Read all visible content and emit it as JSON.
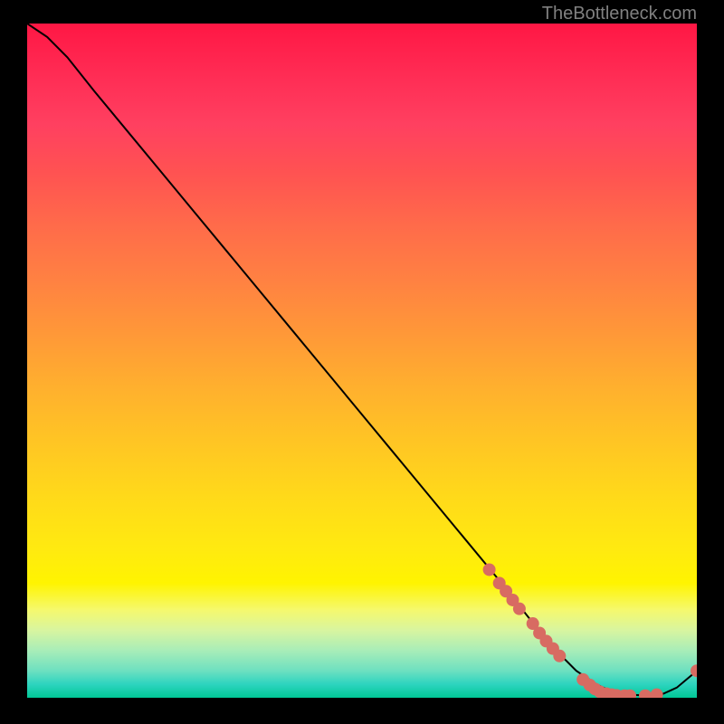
{
  "attribution": "TheBottleneck.com",
  "chart_data": {
    "type": "line",
    "title": "",
    "xlabel": "",
    "ylabel": "",
    "xlim": [
      0,
      100
    ],
    "ylim": [
      0,
      100
    ],
    "series": [
      {
        "name": "curve",
        "x": [
          0,
          3,
          6,
          10,
          15,
          20,
          25,
          30,
          35,
          40,
          45,
          50,
          55,
          60,
          65,
          70,
          74,
          78,
          82,
          85,
          88,
          91,
          93,
          95,
          97,
          100
        ],
        "y": [
          100,
          98,
          95,
          90,
          84,
          78,
          72,
          66,
          60,
          54,
          48,
          42,
          36,
          30,
          24,
          18,
          13,
          8,
          4,
          2,
          0.6,
          0.4,
          0.3,
          0.6,
          1.5,
          4
        ],
        "color": "#000000"
      }
    ],
    "markers": [
      {
        "x": 69.0,
        "y": 19.0
      },
      {
        "x": 70.5,
        "y": 17.0
      },
      {
        "x": 71.5,
        "y": 15.8
      },
      {
        "x": 72.5,
        "y": 14.5
      },
      {
        "x": 73.5,
        "y": 13.2
      },
      {
        "x": 75.5,
        "y": 11.0
      },
      {
        "x": 76.5,
        "y": 9.6
      },
      {
        "x": 77.5,
        "y": 8.4
      },
      {
        "x": 78.5,
        "y": 7.3
      },
      {
        "x": 79.5,
        "y": 6.2
      },
      {
        "x": 83.0,
        "y": 2.7
      },
      {
        "x": 84.0,
        "y": 1.9
      },
      {
        "x": 84.8,
        "y": 1.3
      },
      {
        "x": 85.5,
        "y": 0.9
      },
      {
        "x": 86.5,
        "y": 0.6
      },
      {
        "x": 87.3,
        "y": 0.45
      },
      {
        "x": 88.0,
        "y": 0.35
      },
      {
        "x": 89.2,
        "y": 0.3
      },
      {
        "x": 90.0,
        "y": 0.3
      },
      {
        "x": 92.3,
        "y": 0.3
      },
      {
        "x": 94.0,
        "y": 0.45
      },
      {
        "x": 100.0,
        "y": 4.0
      }
    ],
    "marker_color": "#d86b62",
    "marker_radius": 7
  }
}
